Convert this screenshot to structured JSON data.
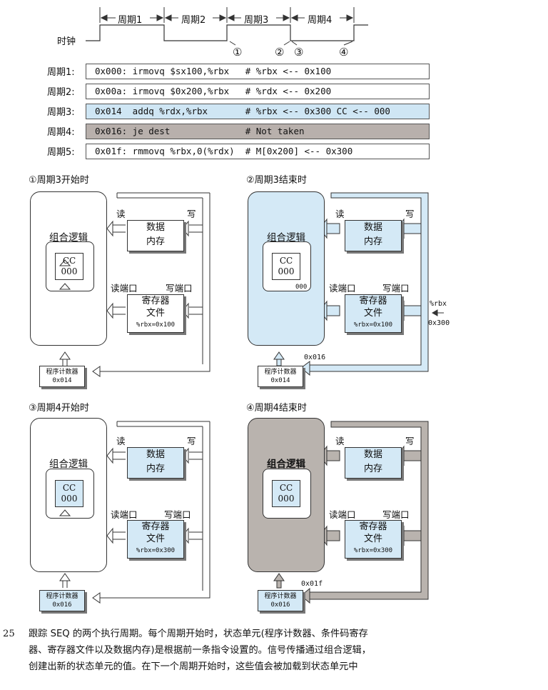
{
  "timing": {
    "clock_label": "时钟",
    "cycle_labels": [
      "周期1",
      "周期2",
      "周期3",
      "周期4"
    ],
    "markers": [
      "①",
      "②",
      "③",
      "④"
    ]
  },
  "instructions": [
    {
      "cycle": "周期1:",
      "text": "0x000: irmovq $sx100,%rbx   # %rbx <-- 0x100"
    },
    {
      "cycle": "周期2:",
      "text": "0x00a: irmovq $0x200,%rbx   # %rdx <-- 0x200"
    },
    {
      "cycle": "周期3:",
      "text": "0x014  addq %rdx,%rbx       # %rbx <-- 0x300 CC <-- 000"
    },
    {
      "cycle": "周期4:",
      "text": "0x016: je dest              # Not taken"
    },
    {
      "cycle": "周期5:",
      "text": "0x01f: rmmovq %rbx,0(%rdx)  # M[0x200] <-- 0x300"
    }
  ],
  "panels": [
    {
      "title": "①周期3开始时",
      "logic_label": "组合逻辑",
      "cc_label": "CC",
      "cc_value": "000",
      "read": "读",
      "write": "写",
      "mem_line1": "数据",
      "mem_line2": "内存",
      "read_port": "读端口",
      "write_port": "写端口",
      "reg_line1": "寄存器",
      "reg_line2": "文件",
      "reg_value": "%rbx=0x100",
      "pc_label": "程序计数器",
      "pc_value": "0x014",
      "cc_out": "",
      "pc_next": "",
      "reg_in_name": "",
      "reg_in_value": ""
    },
    {
      "title": "②周期3结束时",
      "logic_label": "组合逻辑",
      "cc_label": "CC",
      "cc_value": "000",
      "read": "读",
      "write": "写",
      "mem_line1": "数据",
      "mem_line2": "内存",
      "read_port": "读端口",
      "write_port": "写端口",
      "reg_line1": "寄存器",
      "reg_line2": "文件",
      "reg_value": "%rbx=0x100",
      "pc_label": "程序计数器",
      "pc_value": "0x014",
      "cc_out": "000",
      "pc_next": "0x016",
      "reg_in_name": "%rbx",
      "reg_in_value": "0x300"
    },
    {
      "title": "③周期4开始时",
      "logic_label": "组合逻辑",
      "cc_label": "CC",
      "cc_value": "000",
      "read": "读",
      "write": "写",
      "mem_line1": "数据",
      "mem_line2": "内存",
      "read_port": "读端口",
      "write_port": "写端口",
      "reg_line1": "寄存器",
      "reg_line2": "文件",
      "reg_value": "%rbx=0x300",
      "pc_label": "程序计数器",
      "pc_value": "0x016",
      "cc_out": "",
      "pc_next": "",
      "reg_in_name": "",
      "reg_in_value": ""
    },
    {
      "title": "④周期4结束时",
      "logic_label": "组合逻辑",
      "cc_label": "CC",
      "cc_value": "000",
      "read": "读",
      "write": "写",
      "mem_line1": "数据",
      "mem_line2": "内存",
      "read_port": "读端口",
      "write_port": "写端口",
      "reg_line1": "寄存器",
      "reg_line2": "文件",
      "reg_value": "%rbx=0x300",
      "pc_label": "程序计数器",
      "pc_value": "0x016",
      "cc_out": "",
      "pc_next": "0x01f",
      "reg_in_name": "",
      "reg_in_value": ""
    }
  ],
  "caption": {
    "number": "25",
    "line1": "跟踪 SEQ 的两个执行周期。每个周期开始时，状态单元(程序计数器、条件码寄存",
    "line2": "器、寄存器文件以及数据内存)是根据前一条指令设置的。信号传播通过组合逻辑，",
    "line3": "创建出新的状态单元的值。在下一个周期开始时，这些值会被加载到状态单元中"
  },
  "colors": {
    "blue_fill": "#d4e9f6",
    "blue_row": "#cfe6f4",
    "gray_row": "#b8b0ac",
    "gray_fill": "#b9b3ae"
  }
}
